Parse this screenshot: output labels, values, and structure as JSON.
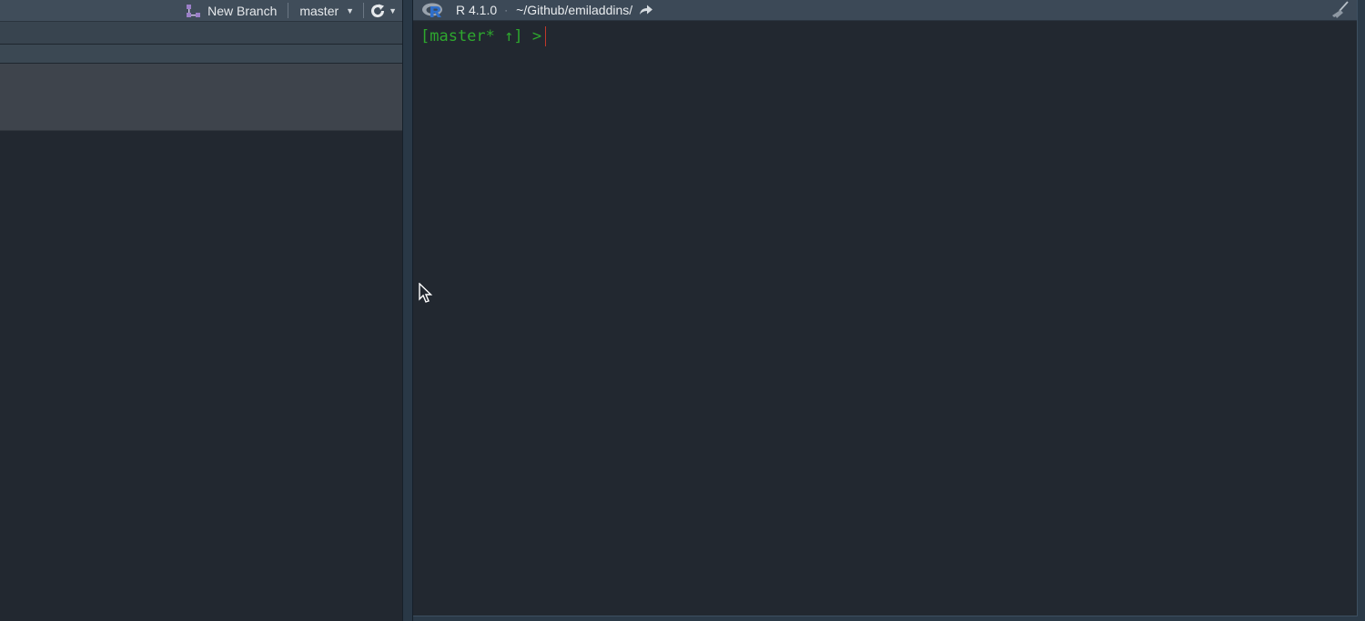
{
  "git_pane": {
    "toolbar": {
      "new_branch_label": "New Branch",
      "branch_label": "master",
      "new_branch_icon": "branch-icon",
      "refresh_icon": "refresh-icon"
    }
  },
  "console_pane": {
    "header": {
      "r_version": "R 4.1.0",
      "separator": "·",
      "working_directory": "~/Github/emiladdins/",
      "icons": [
        "r-logo-icon",
        "goto-directory-icon",
        "broom-icon"
      ]
    },
    "prompt": "[master* ↑] >"
  },
  "colors": {
    "prompt_green": "#2ea82e",
    "cursor_red": "#c0392b",
    "background": "#222830",
    "toolbar": "#404d5a"
  }
}
